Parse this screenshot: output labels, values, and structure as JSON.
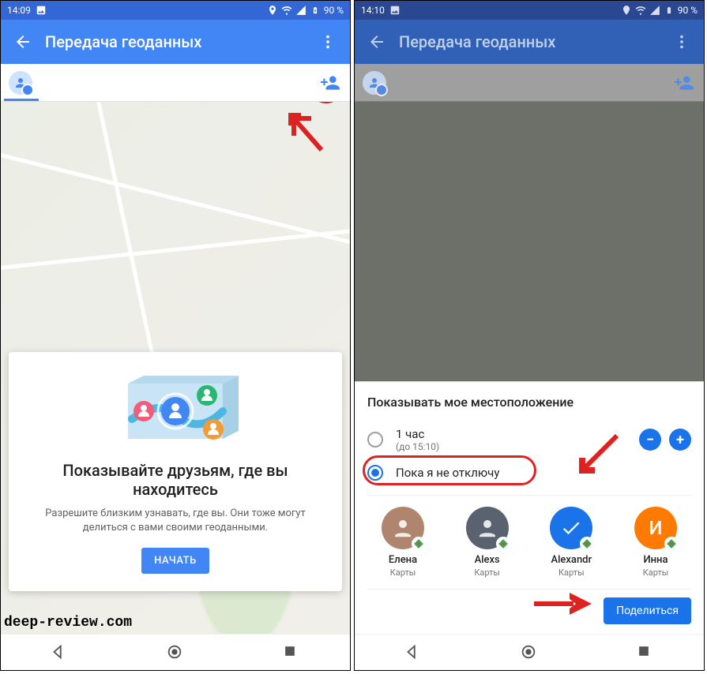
{
  "left": {
    "status": {
      "time": "14:09",
      "battery": "90 %"
    },
    "appbar_title": "Передача геоданных",
    "card": {
      "title": "Показывайте друзьям, где вы находитесь",
      "body": "Разрешите близким узнавать, где вы. Они тоже могут делиться с вами своими геоданными.",
      "button": "НАЧАТЬ"
    }
  },
  "right": {
    "status": {
      "time": "14:10",
      "battery": "90 %"
    },
    "appbar_title": "Передача геоданных",
    "sheet": {
      "heading": "Показывать мое местоположение",
      "opt1_label": "1 час",
      "opt1_sub": "(до 15:10)",
      "opt2_label": "Пока я не отключу",
      "share_button": "Поделиться"
    },
    "contacts": [
      {
        "name": "Елена",
        "source": "Карты",
        "color": "#b0856e",
        "letter": "",
        "selected": false,
        "photo": true
      },
      {
        "name": "Alexs",
        "source": "Карты",
        "color": "#5a6270",
        "letter": "",
        "selected": false,
        "photo": true
      },
      {
        "name": "Alexandr",
        "source": "Карты",
        "color": "#1a73e8",
        "letter": "",
        "selected": true,
        "photo": false
      },
      {
        "name": "Инна",
        "source": "Карты",
        "color": "#ff7a00",
        "letter": "И",
        "selected": false,
        "photo": false
      }
    ]
  },
  "watermark": "deep-review.com",
  "colors": {
    "primary": "#4285f4",
    "accent": "#1a73e8",
    "anno": "#d22"
  }
}
